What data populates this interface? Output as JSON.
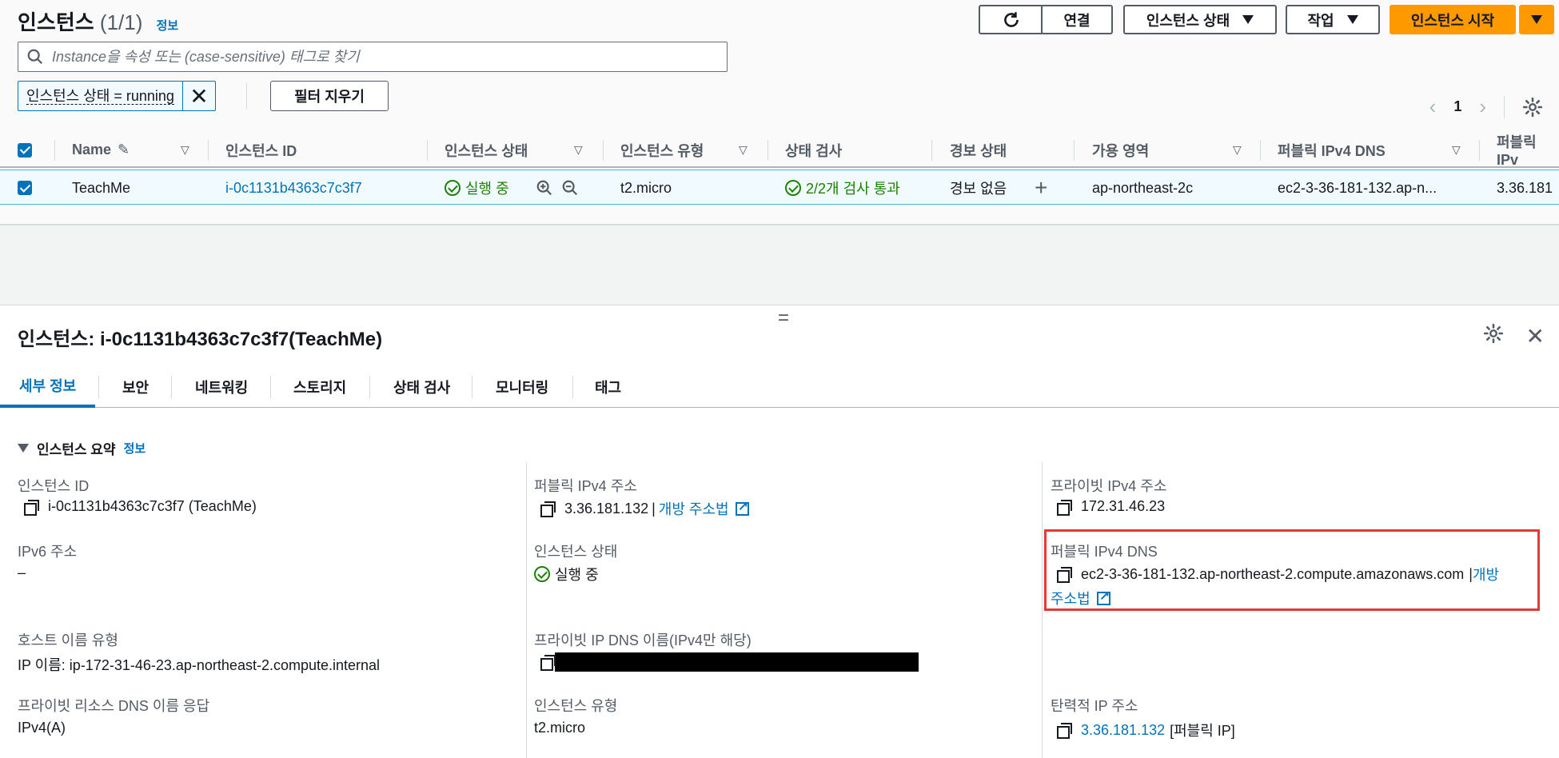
{
  "header": {
    "title": "인스턴스",
    "count": "(1/1)",
    "info": "정보",
    "refresh_icon": "refresh-icon",
    "connect_label": "연결",
    "instance_state_label": "인스턴스 상태",
    "actions_label": "작업",
    "launch_label": "인스턴스 시작"
  },
  "search": {
    "placeholder": "Instance을 속성 또는 (case-sensitive) 태그로 찾기"
  },
  "filter": {
    "token": "인스턴스 상태 = running",
    "clear_label": "필터 지우기"
  },
  "pagination": {
    "page": "1",
    "prev": "‹",
    "next": "›"
  },
  "table": {
    "headers": {
      "name": "Name",
      "instance_id": "인스턴스 ID",
      "instance_state": "인스턴스 상태",
      "instance_type": "인스턴스 유형",
      "status_check": "상태 검사",
      "alarm_status": "경보 상태",
      "az": "가용 영역",
      "public_dns": "퍼블릭 IPv4 DNS",
      "public_ip": "퍼블릭 IPv"
    },
    "row": {
      "name": "TeachMe",
      "instance_id": "i-0c1131b4363c7c3f7",
      "state": "실행 중",
      "type": "t2.micro",
      "status_check": "2/2개 검사 통과",
      "alarm": "경보 없음",
      "az": "ap-northeast-2c",
      "public_dns": "ec2-3-36-181-132.ap-n...",
      "public_ip": "3.36.181"
    }
  },
  "detail": {
    "title": "인스턴스: i-0c1131b4363c7c3f7(TeachMe)",
    "drag_handle": "=",
    "tabs": [
      "세부 정보",
      "보안",
      "네트워킹",
      "스토리지",
      "상태 검사",
      "모니터링",
      "태그"
    ],
    "section_title": "인스턴스 요약",
    "section_info": "정보",
    "fields": {
      "instance_id_label": "인스턴스 ID",
      "instance_id_value": "i-0c1131b4363c7c3f7 (TeachMe)",
      "public_ipv4_label": "퍼블릭 IPv4 주소",
      "public_ipv4_value": "3.36.181.132",
      "open_address": "개방 주소법",
      "private_ipv4_label": "프라이빗 IPv4 주소",
      "private_ipv4_value": "172.31.46.23",
      "ipv6_label": "IPv6 주소",
      "ipv6_value": "–",
      "state_label": "인스턴스 상태",
      "state_value": "실행 중",
      "public_dns_label": "퍼블릭 IPv4 DNS",
      "public_dns_value": "ec2-3-36-181-132.ap-northeast-2.compute.amazonaws.com",
      "open_address_part1": "개방",
      "open_address_part2": "주소법",
      "hostname_type_label": "호스트 이름 유형",
      "hostname_type_value": "IP 이름: ip-172-31-46-23.ap-northeast-2.compute.internal",
      "private_dns_label": "프라이빗 IP DNS 이름(IPv4만 해당)",
      "private_resource_dns_label": "프라이빗 리소스 DNS 이름 응답",
      "private_resource_dns_value": "IPv4(A)",
      "instance_type_label": "인스턴스 유형",
      "instance_type_value": "t2.micro",
      "elastic_ip_label": "탄력적 IP 주소",
      "elastic_ip_value": "3.36.181.132",
      "elastic_ip_suffix": "[퍼블릭 IP]"
    }
  },
  "colors": {
    "accent": "#0073bb",
    "primary_button": "#ff9900",
    "success": "#1d8102",
    "highlight": "#e53935"
  }
}
